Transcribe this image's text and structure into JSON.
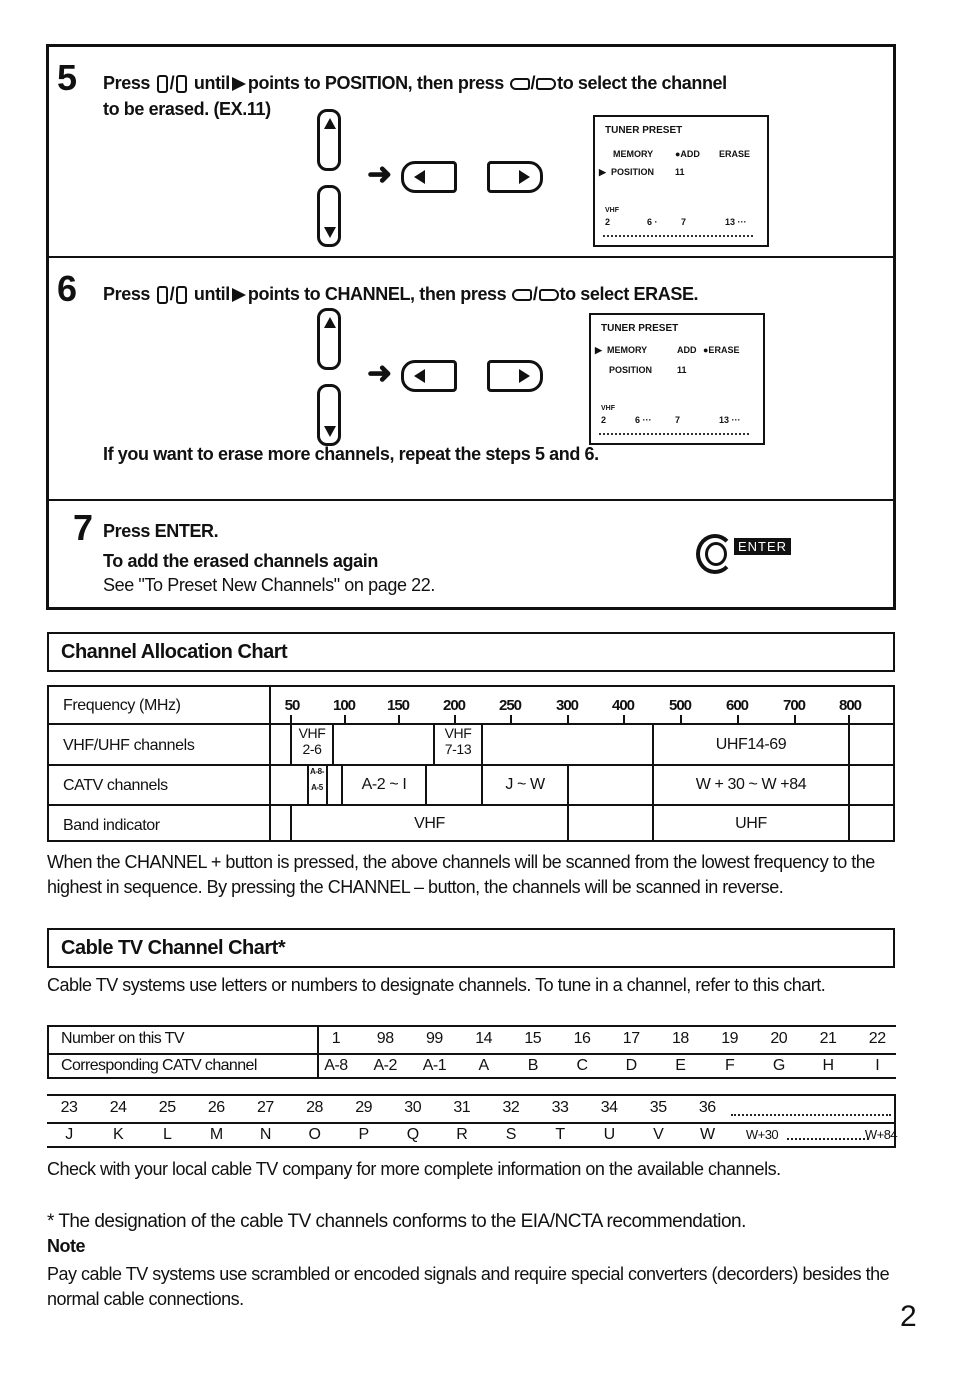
{
  "steps": [
    {
      "number": "5",
      "text_parts": [
        "Press",
        "/",
        "until",
        "points to POSITION, then press",
        "/",
        "to select the channel"
      ],
      "line2": "to be erased. (EX.11)",
      "screen": {
        "title": "TUNER PRESET",
        "row1": [
          "MEMORY",
          "●ADD",
          "ERASE"
        ],
        "row2_pointer": "▶",
        "row2": [
          "POSITION",
          "11"
        ],
        "band": "VHF",
        "scale": [
          "2",
          "6 ·",
          "7",
          "13 ···"
        ]
      }
    },
    {
      "number": "6",
      "text_parts": [
        "Press",
        "/",
        "until",
        "points to CHANNEL, then press",
        "/",
        "to select ERASE."
      ],
      "screen": {
        "title": "TUNER PRESET",
        "row1_pointer": "▶",
        "row1": [
          "MEMORY",
          "ADD",
          "●ERASE"
        ],
        "row2": [
          "POSITION",
          "11"
        ],
        "band": "VHF",
        "scale": [
          "2",
          "6 ···",
          "7",
          "13 ···"
        ]
      },
      "note": "If you want to erase more channels, repeat the steps 5 and 6."
    },
    {
      "number": "7",
      "title": "Press ENTER.",
      "subtitle": "To add the erased channels again",
      "text": "See \"To Preset New Channels\" on page 22.",
      "enter_label": "ENTER"
    }
  ],
  "allocation": {
    "title": "Channel Allocation Chart",
    "row_labels": [
      "Frequency (MHz)",
      "VHF/UHF channels",
      "CATV channels",
      "Band indicator"
    ],
    "frequencies": [
      "50",
      "100",
      "150",
      "200",
      "250",
      "300",
      "400",
      "500",
      "600",
      "700",
      "800"
    ],
    "vhf_uhf": {
      "vhf_low": "VHF\n2-6",
      "vhf_low_l1": "VHF",
      "vhf_low_l2": "2-6",
      "vhf_high_l1": "VHF",
      "vhf_high_l2": "7-13",
      "uhf": "UHF14-69"
    },
    "catv": {
      "a8_l1": "A-8-",
      "a8_l2": "A-5",
      "a2": "A-2 ~ I",
      "jw": "J ~ W",
      "w30": "W + 30 ~ W +84"
    },
    "band": {
      "vhf": "VHF",
      "uhf": "UHF"
    },
    "description": "When the CHANNEL + button is pressed, the above channels will be scanned from the lowest frequency to the highest in sequence. By pressing the CHANNEL – button, the channels will be scanned in reverse."
  },
  "cable": {
    "title": "Cable TV Channel Chart*",
    "intro": "Cable TV systems use letters or numbers to designate channels. To tune in a channel, refer to this chart.",
    "label_tv": "Number on this TV",
    "label_catv": "Corresponding CATV channel",
    "row1_tv": [
      "1",
      "98",
      "99",
      "14",
      "15",
      "16",
      "17",
      "18",
      "19",
      "20",
      "21",
      "22"
    ],
    "row1_catv": [
      "A-8",
      "A-2",
      "A-1",
      "A",
      "B",
      "C",
      "D",
      "E",
      "F",
      "G",
      "H",
      "I"
    ],
    "row2_tv": [
      "23",
      "24",
      "25",
      "26",
      "27",
      "28",
      "29",
      "30",
      "31",
      "32",
      "33",
      "34",
      "35",
      "36"
    ],
    "row2_catv": [
      "J",
      "K",
      "L",
      "M",
      "N",
      "O",
      "P",
      "Q",
      "R",
      "S",
      "T",
      "U",
      "V",
      "W"
    ],
    "row2_catv_ext_start": "W+30",
    "row2_catv_ext_end": "W+84",
    "check": "Check with your local cable TV company for more complete information on the available channels.",
    "footnote": "* The designation of the cable TV channels conforms to the EIA/NCTA recommendation.",
    "note_title": "Note",
    "note_text": "Pay cable TV systems use scrambled or encoded signals and require special converters (decorders) besides the normal cable connections."
  },
  "page_number": "2"
}
